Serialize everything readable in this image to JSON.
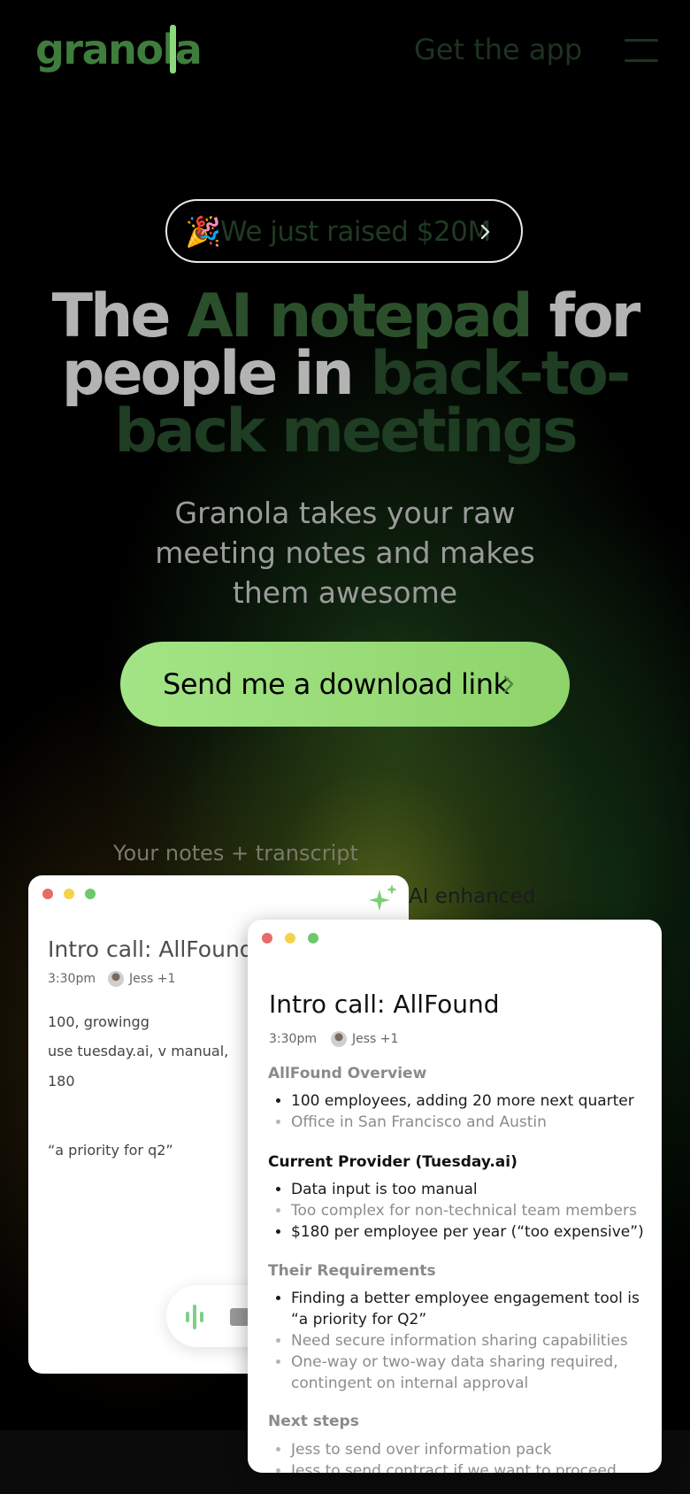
{
  "header": {
    "logo": "granola",
    "get_app": "Get the app",
    "menu_icon": "hamburger-menu-icon"
  },
  "announcement": {
    "emoji": "🎉",
    "text": "We just raised $20M",
    "icon": "chevron-right-icon"
  },
  "hero": {
    "line1_a": "The ",
    "line1_b": "AI notepad",
    "line1_c": " for",
    "line2_a": "people in ",
    "line2_b": "back-to-",
    "line3": "back meetings",
    "subtitle": "Granola takes your raw meeting notes and makes them awesome"
  },
  "cta": {
    "label": "Send me a download link",
    "icon": "chevron-right-icon"
  },
  "labels": {
    "notes": "Your notes + transcript",
    "ai": "AI enhanced"
  },
  "notes_card": {
    "title": "Intro call: AllFound",
    "time": "3:30pm",
    "attendees": "Jess +1",
    "lines": [
      "100, growingg",
      "use tuesday.ai, v manual,",
      "180",
      "“a priority for q2”"
    ],
    "icons": [
      "sparkle-icon",
      "audio-wave-icon",
      "stop-icon"
    ]
  },
  "ai_card": {
    "title": "Intro call: AllFound",
    "time": "3:30pm",
    "attendees": "Jess +1",
    "sections": [
      {
        "heading": "AllFound Overview",
        "items": [
          "100 employees, adding 20 more next quarter",
          "Office in San Francisco and Austin"
        ]
      },
      {
        "heading": "Current Provider (Tuesday.ai)",
        "items": [
          "Data input is too manual",
          "Too complex for non-technical team members",
          "$180 per employee per year (“too expensive”)"
        ]
      },
      {
        "heading": "Their Requirements",
        "items": [
          "Finding a better employee engagement tool is “a priority for Q2”",
          "Need secure information sharing capabilities",
          "One-way or two-way data sharing required, contingent on internal approval"
        ]
      },
      {
        "heading": "Next steps",
        "items": [
          "Jess to send over information pack",
          "Jess to send contract if we want to proceed"
        ]
      }
    ]
  },
  "colors": {
    "accent_green": "#8fd36b",
    "logo_green": "#3f7d3c",
    "traffic_red": "#e66a6a",
    "traffic_yellow": "#f5d24c",
    "traffic_green": "#6cc96a"
  }
}
